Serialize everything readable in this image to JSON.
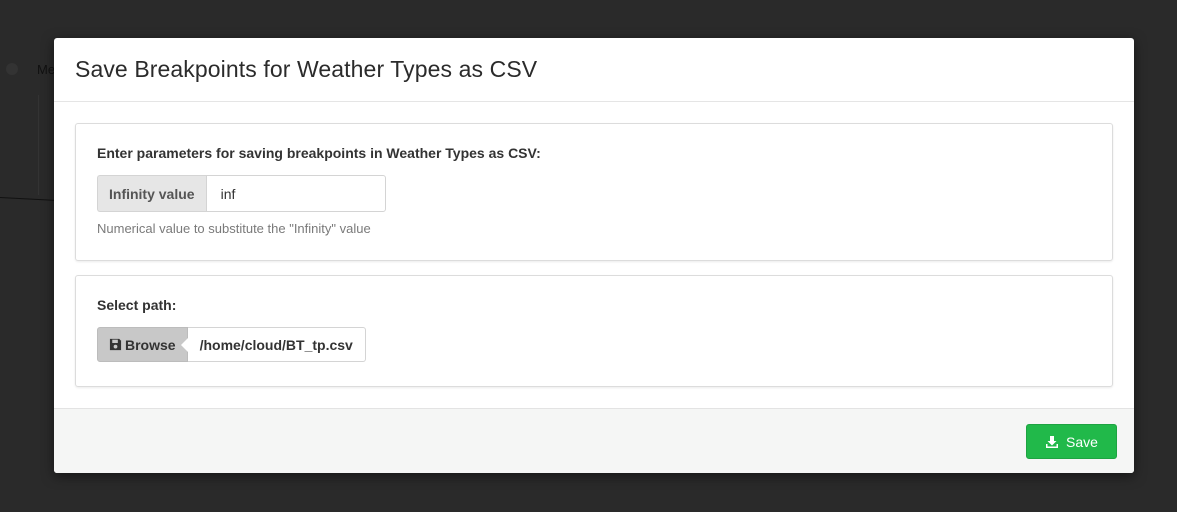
{
  "background": {
    "menu_text": "Me"
  },
  "modal": {
    "title": "Save Breakpoints for Weather Types as CSV",
    "params_panel": {
      "heading": "Enter parameters for saving breakpoints in Weather Types as CSV:",
      "infinity_label": "Infinity value",
      "infinity_value": "inf",
      "help": "Numerical value to substitute the \"Infinity\" value"
    },
    "path_panel": {
      "heading": "Select path:",
      "browse_label": "Browse",
      "browse_icon": "floppy-disk-icon",
      "path_value": "/home/cloud/BT_tp.csv"
    },
    "footer": {
      "save_label": "Save",
      "save_icon": "download-icon",
      "save_color": "#21b94a"
    }
  }
}
